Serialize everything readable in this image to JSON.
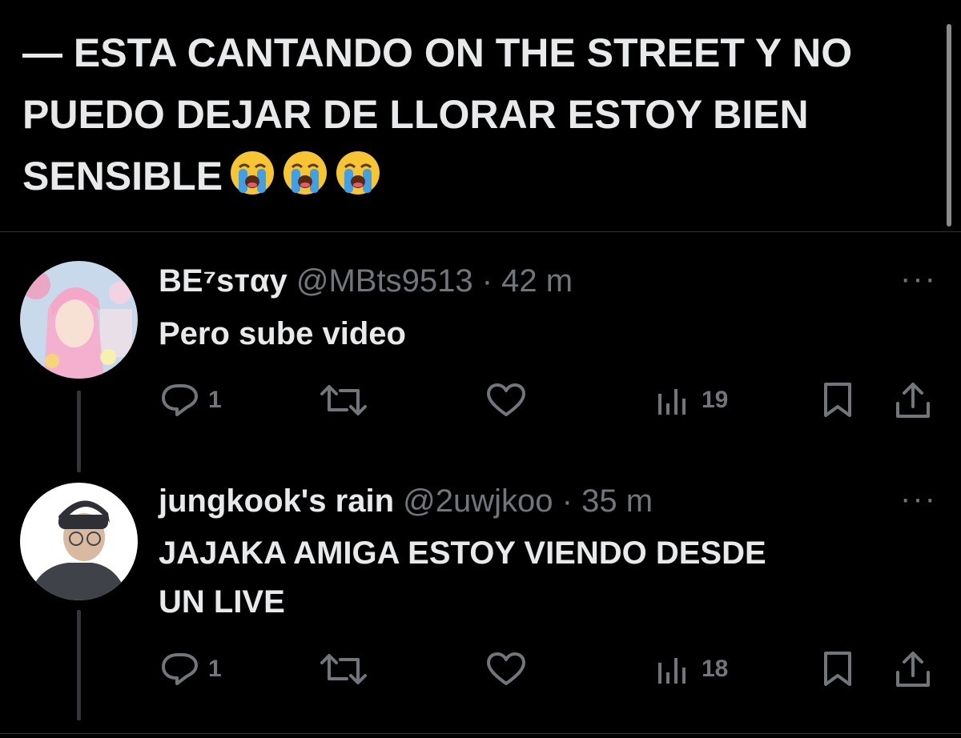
{
  "top_tweet": {
    "line1": "— ESTA CANTANDO ON THE STREET Y NO",
    "line2": "PUEDO DEJAR DE LLORAR ESTOY BIEN",
    "line3": "SENSIBLE",
    "emoji_name": "loudly-crying-face-emoji",
    "emoji_count": 3
  },
  "replies": [
    {
      "display_name": "BE⁷sтαy",
      "handle": "@MBts9513",
      "separator": "·",
      "time": "42 m",
      "more": "···",
      "text": "Pero sube video",
      "reply_count": "1",
      "views": "19"
    },
    {
      "display_name": "jungkook's rain",
      "handle": "@2uwjkoo",
      "separator": "·",
      "time": "35 m",
      "more": "···",
      "text_line1": "JAJAKA AMIGA ESTOY VIENDO DESDE",
      "text_line2": "UN LIVE",
      "reply_count": "1",
      "views": "18"
    }
  ],
  "icons": [
    "reply-icon",
    "retweet-icon",
    "like-icon",
    "views-icon",
    "bookmark-icon",
    "share-icon"
  ],
  "colors": {
    "background": "#000000",
    "text": "#e7e9ea",
    "muted": "#71767b",
    "divider": "#2f3336"
  }
}
